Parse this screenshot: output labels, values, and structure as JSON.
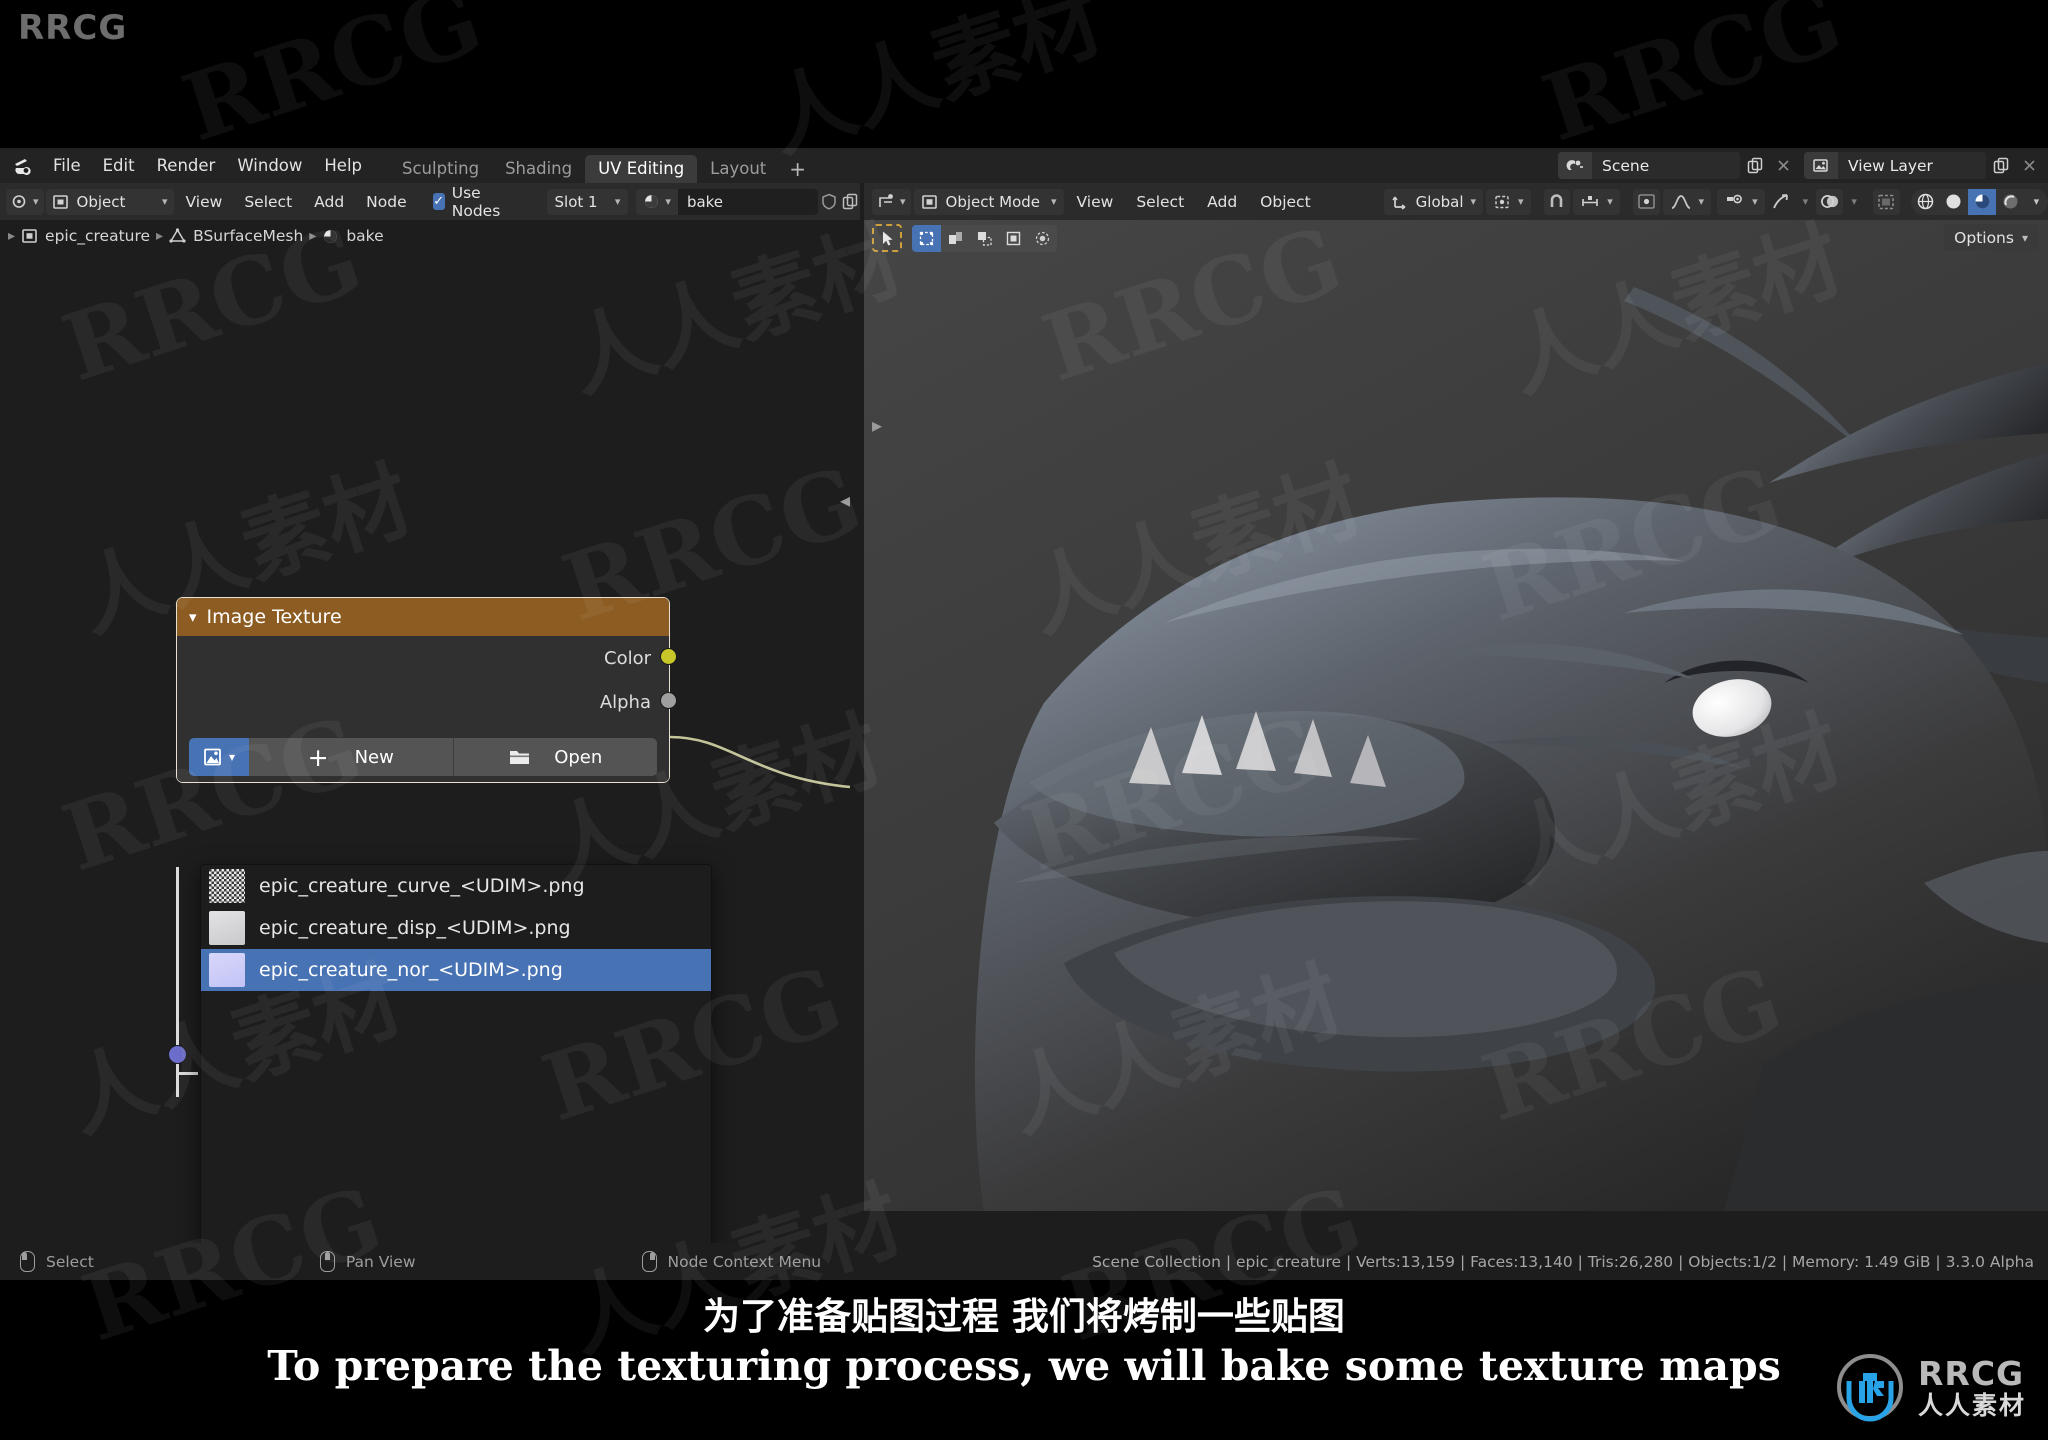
{
  "watermark": {
    "brand": "RRCG",
    "brand_cn": "人人素材"
  },
  "topbar": {
    "logo_icon": "blender-logo-icon",
    "menus": [
      "File",
      "Edit",
      "Render",
      "Window",
      "Help"
    ],
    "workspaces": [
      {
        "label": "Sculpting",
        "active": false
      },
      {
        "label": "Shading",
        "active": false
      },
      {
        "label": "UV Editing",
        "active": true
      },
      {
        "label": "Layout",
        "active": false
      }
    ],
    "add_workspace": "+",
    "scene": {
      "label": "Scene",
      "icon": "scene-icon",
      "new_icon": "duplicate-icon",
      "remove_icon": "close-icon"
    },
    "view_layer": {
      "label": "View Layer",
      "icon": "view-layer-icon",
      "new_icon": "duplicate-icon",
      "remove_icon": "close-icon"
    }
  },
  "node_editor": {
    "editor_type_icon": "shader-editor-icon",
    "shader_type": "Object",
    "menus": [
      "View",
      "Select",
      "Add",
      "Node"
    ],
    "use_nodes": {
      "label": "Use Nodes",
      "checked": true
    },
    "slot": "Slot 1",
    "material": {
      "icon": "material-icon",
      "name": "bake",
      "shield_icon": "fake-user-icon",
      "copy_icon": "duplicate-icon"
    },
    "breadcrumb": [
      {
        "icon": "object-icon",
        "label": "epic_creature"
      },
      {
        "icon": "mesh-data-icon",
        "label": "BSurfaceMesh"
      },
      {
        "icon": "material-icon",
        "label": "bake"
      }
    ],
    "node": {
      "title": "Image Texture",
      "collapse_icon": "chevron-down-icon",
      "outputs": [
        {
          "label": "Color",
          "color": "#c7c729"
        },
        {
          "label": "Alpha",
          "color": "#9f9f9f"
        }
      ],
      "image_browse_icon": "image-icon",
      "new_label": "New",
      "new_icon": "plus-icon",
      "open_label": "Open",
      "open_icon": "folder-icon"
    },
    "dropdown": {
      "items": [
        {
          "label": "epic_creature_curve_<UDIM>.png",
          "thumb": "noise-thumbnail",
          "selected": false
        },
        {
          "label": "epic_creature_disp_<UDIM>.png",
          "thumb": "flat-gray-thumbnail",
          "selected": false
        },
        {
          "label": "epic_creature_nor_<UDIM>.png",
          "thumb": "normal-map-thumbnail",
          "selected": true
        }
      ],
      "search": {
        "icon": "search-icon",
        "value": "",
        "placeholder": ""
      }
    }
  },
  "viewport_3d": {
    "editor_type_icon": "3d-viewport-icon",
    "mode": "Object Mode",
    "mode_icon": "object-mode-icon",
    "menus": [
      "View",
      "Select",
      "Add",
      "Object"
    ],
    "transform_orientation": {
      "icon": "orientation-icon",
      "label": "Global"
    },
    "pivot_icon": "pivot-point-icon",
    "snap_icon": "snap-magnet-icon",
    "snap_to_icon": "snap-increment-icon",
    "proportional_icon": "proportional-edit-icon",
    "falloff_icon": "falloff-curve-icon",
    "visibility_icon": "show-hide-icon",
    "gizmo_icon": "gizmo-icon",
    "overlays_icon": "overlays-icon",
    "xray_icon": "xray-icon",
    "shading": [
      {
        "icon": "wireframe-icon",
        "active": false
      },
      {
        "icon": "solid-icon",
        "active": false
      },
      {
        "icon": "material-preview-icon",
        "active": true
      },
      {
        "icon": "rendered-icon",
        "active": false
      }
    ],
    "shading_dropdown_icon": "chevron-down-icon",
    "tool_icon": "tweak-select-tool-icon",
    "select_modes": [
      {
        "icon": "vertex-select-icon",
        "active": true
      },
      {
        "icon": "edge-select-icon",
        "active": false
      },
      {
        "icon": "face-select-icon",
        "active": false
      },
      {
        "icon": "island-select-icon",
        "active": false
      },
      {
        "icon": "uv-sync-icon",
        "active": false
      }
    ],
    "options": {
      "label": "Options",
      "icon": "chevron-down-icon"
    }
  },
  "statusbar": {
    "hints": [
      {
        "icon": "mouse-left-icon",
        "label": "Select"
      },
      {
        "icon": "mouse-middle-icon",
        "label": "Pan View"
      },
      {
        "icon": "mouse-right-icon",
        "label": "Node Context Menu"
      }
    ],
    "scene_stats": "Scene Collection | epic_creature | Verts:13,159 | Faces:13,140 | Tris:26,280 | Objects:1/2 | Memory: 1.49 GiB | 3.3.0 Alpha"
  },
  "subtitle": {
    "chinese": "为了准备贴图过程 我们将烤制一些贴图",
    "english": "To prepare the texturing process, we will bake some texture maps"
  },
  "colors": {
    "accent_blue": "#4772b3",
    "node_header_orange": "#8c5c22",
    "socket_color": "#c7c729",
    "socket_alpha": "#9f9f9f",
    "socket_vector": "#6d6dcc",
    "tool_outline": "#cf9f3d",
    "logo_blue": "#29a3e8"
  }
}
